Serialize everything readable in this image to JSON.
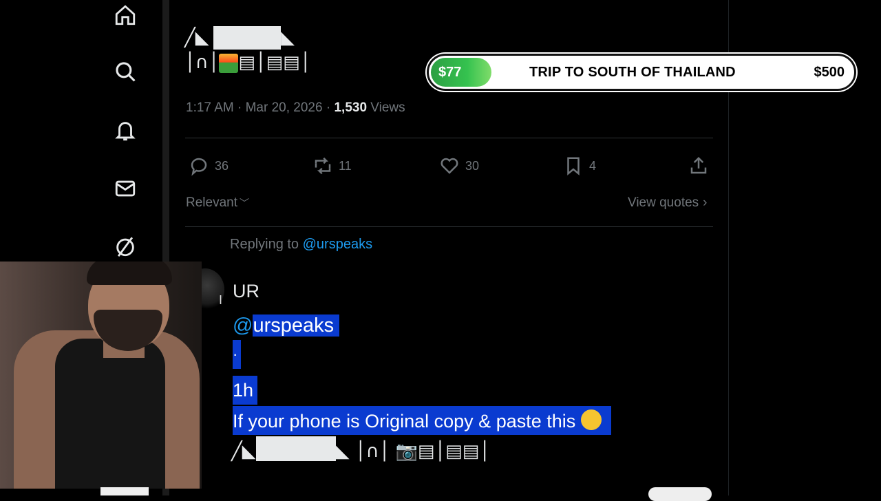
{
  "nav": {
    "items": [
      {
        "name": "home-icon"
      },
      {
        "name": "search-icon"
      },
      {
        "name": "notifications-icon"
      },
      {
        "name": "messages-icon"
      },
      {
        "name": "grok-icon"
      }
    ]
  },
  "tweet": {
    "art_row1": "╱◣",
    "art_row1_end": "◣",
    "art_row2_a": "│∩│",
    "art_row2_b": "▤│▤▤│",
    "time": "1:17 AM",
    "sep1": " · ",
    "date": "Mar 20, 2026",
    "sep2": " · ",
    "views": "1,530",
    "views_label": " Views",
    "stats": {
      "replies": "36",
      "reposts": "11",
      "likes": "30",
      "bookmarks": "4"
    }
  },
  "sort": {
    "label": "Relevant",
    "view_quotes": "View quotes"
  },
  "goal": {
    "current": "$77",
    "title": "TRIP TO SOUTH OF THAILAND",
    "target": "$500",
    "progress": 0.154,
    "fill_color": "#35c24f"
  },
  "reply": {
    "replying_prefix": "Replying to ",
    "replying_handle": "@urspeaks",
    "name": "UR",
    "handle_at": "@",
    "handle": "urspeaks",
    "dot": "·",
    "time": "1h",
    "text": "If your phone is Original copy & paste this",
    "art_a": "╱◣",
    "art_b": "◣ │∩│ ",
    "art_c": "📷▤│▤▤│"
  },
  "colors": {
    "accent": "#1d9bf0",
    "selection": "#0a3bd0"
  }
}
